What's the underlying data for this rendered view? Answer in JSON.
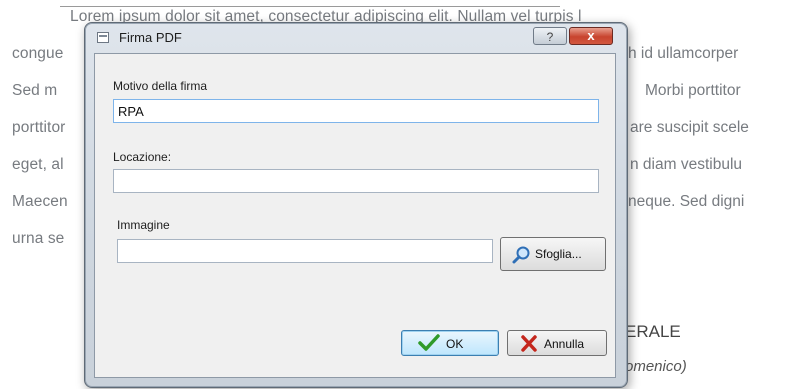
{
  "document": {
    "lines": [
      "Lorem ipsum dolor sit amet, consectetur adipiscing elit. Nullam vel turpis l",
      "congue",
      "Sed m",
      "porttitor",
      "eget, al",
      "Maecen",
      "urna se"
    ],
    "right_fragments": [
      "h id ullamcorper",
      "Morbi  porttitor",
      "are suscipit scele",
      "n  diam  vestibulu",
      "neque. Sed digni"
    ],
    "signature_title": "ERALE",
    "signature_name": "omenico)"
  },
  "dialog": {
    "title": "Firma PDF",
    "help_label": "?",
    "close_label": "x",
    "reason_label": "Motivo della firma",
    "reason_value": "RPA",
    "location_label": "Locazione:",
    "location_value": "",
    "image_label": "Immagine",
    "image_value": "",
    "browse_label": "Sfoglia...",
    "ok_label": "OK",
    "cancel_label": "Annulla"
  },
  "icons": {
    "browse": "magnifier-icon",
    "ok": "checkmark-icon",
    "cancel": "x-cross-icon"
  },
  "colors": {
    "close_red": "#c8442f",
    "ok_check_green": "#2f9a2a",
    "cancel_x_red": "#c4261c",
    "browse_blue": "#2f6fb6"
  }
}
